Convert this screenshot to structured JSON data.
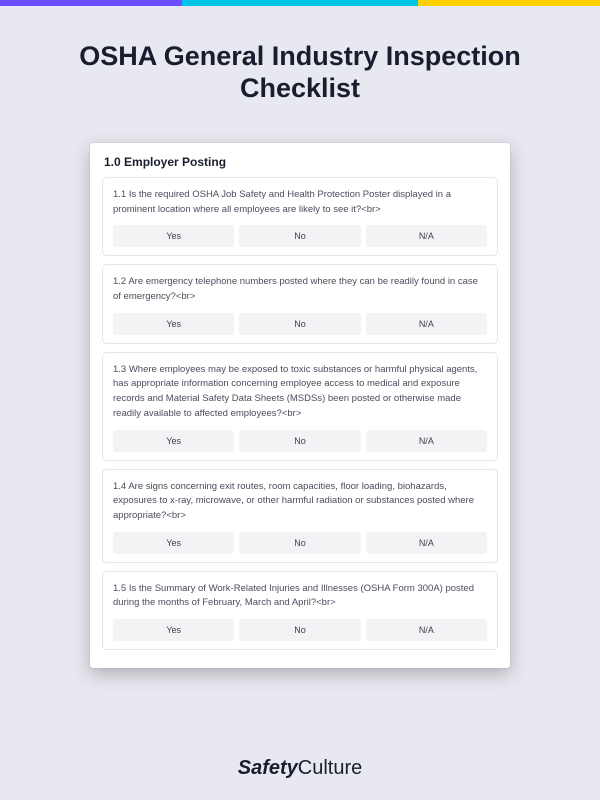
{
  "title": "OSHA General Industry Inspection Checklist",
  "section": {
    "heading": "1.0 Employer Posting",
    "options": {
      "yes": "Yes",
      "no": "No",
      "na": "N/A"
    },
    "questions": [
      {
        "text": "1.1 Is the required OSHA Job Safety and Health Protection Poster displayed in a prominent location where all employees are likely to see it?<br>"
      },
      {
        "text": "1.2 Are emergency telephone numbers posted where they can be readily found in case of emergency?<br>"
      },
      {
        "text": "1.3 Where employees may be exposed to toxic substances or harmful physical agents, has appropriate information concerning employee access to medical and exposure records and Material Safety Data Sheets (MSDSs) been posted or otherwise made readily available to affected employees?<br>"
      },
      {
        "text": "1.4 Are signs concerning exit routes, room capacities, floor loading, biohazards, exposures to x-ray, microwave, or other harmful radiation or substances posted where appropriate?<br>"
      },
      {
        "text": "1.5 Is the Summary of Work-Related Injuries and Illnesses (OSHA Form 300A) posted during the months of February, March and April?<br>"
      }
    ]
  },
  "footer": {
    "brand_bold": "Safety",
    "brand_light": "Culture"
  }
}
